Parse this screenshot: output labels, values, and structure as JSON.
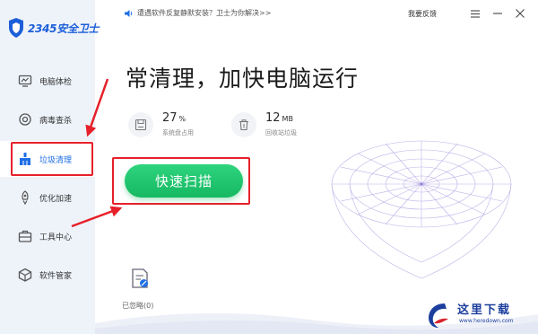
{
  "app": {
    "logo_text": "2345安全卫士"
  },
  "sidebar": {
    "items": [
      {
        "label": "电脑体检",
        "icon": "monitor-icon"
      },
      {
        "label": "病毒查杀",
        "icon": "shield-scan-icon"
      },
      {
        "label": "垃圾清理",
        "icon": "broom-icon",
        "active": true
      },
      {
        "label": "优化加速",
        "icon": "rocket-icon"
      },
      {
        "label": "工具中心",
        "icon": "toolbox-icon"
      },
      {
        "label": "软件管家",
        "icon": "box-icon"
      }
    ]
  },
  "topbar": {
    "notice": "遭遇软件反复静默安装？卫士为你解决>>",
    "feedback": "我要反馈"
  },
  "main": {
    "headline": "常清理，加快电脑运行",
    "stats": [
      {
        "value": "27",
        "unit": "%",
        "caption": "系统盘占用"
      },
      {
        "value": "12",
        "unit": "MB",
        "caption": "回收站垃圾"
      }
    ],
    "scan_button": "快速扫描",
    "ignored_label": "已忽略(0)"
  },
  "watermark": {
    "text": "这里下载",
    "url": "www.heredown.com"
  },
  "colors": {
    "accent": "#1f6fe5",
    "scan_green": "#1fc46c",
    "annotation_red": "#e6202a",
    "sidebar_bg": "#eef3fa"
  }
}
